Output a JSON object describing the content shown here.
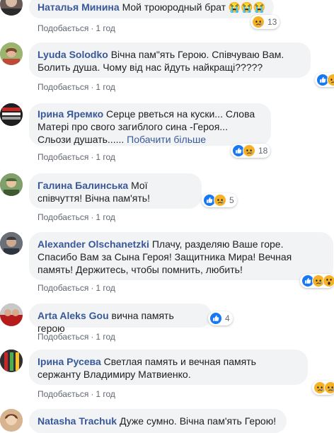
{
  "like_label": "Подобається",
  "comments": [
    {
      "author": "Наталья Минина",
      "text": "Мой троюродный брат 😭😭😭",
      "time": "1 год",
      "reaction_count": "13"
    },
    {
      "author": "Lyuda Solodko",
      "text": "Вічна пам\"ять Герою. Співчуваю Вам. Болить душа. Чому від нас йдуть найкращі?????",
      "time": "1 год"
    },
    {
      "author": "Ірина Яремко",
      "text": "Серце рветься на куски... Слова Матері про свого загиблого сина -Героя... Сльози душать......",
      "see_more": "Побачити більше",
      "time": "1 год",
      "reaction_count": "18"
    },
    {
      "author": "Галина Балинська",
      "text": "Мої співчуття! Вічна пам'ять!",
      "time": "1 год",
      "reaction_count": "5"
    },
    {
      "author": "Alexander Olschanetzki",
      "text": "Плачу, разделяю Ваше горе. Спасибо Вам за Сына Героя! Защитника Мира! Вечная память! Держитесь, чтобы помнить, любить!",
      "time": "1 год"
    },
    {
      "author": "Arta Aleks Gou",
      "text": "вична память герою",
      "time": "1 год",
      "reaction_count": "4"
    },
    {
      "author": "Ірина Русева",
      "text": "Светлая память и вечная память сержанту Владимиру Матвиенко.",
      "time": "1 год"
    },
    {
      "author": "Natasha Trachuk",
      "text": "Дуже сумно. Вічна пам'ять Герою!"
    }
  ],
  "icons": {
    "like": "like-reaction-icon",
    "sad": "sad-reaction-icon",
    "wow": "wow-reaction-icon"
  },
  "colors": {
    "link": "#385898",
    "bubble": "#f2f3f5",
    "meta": "#606770",
    "like_blue": "#1877f2",
    "sad_yellow": "#f7b125"
  }
}
